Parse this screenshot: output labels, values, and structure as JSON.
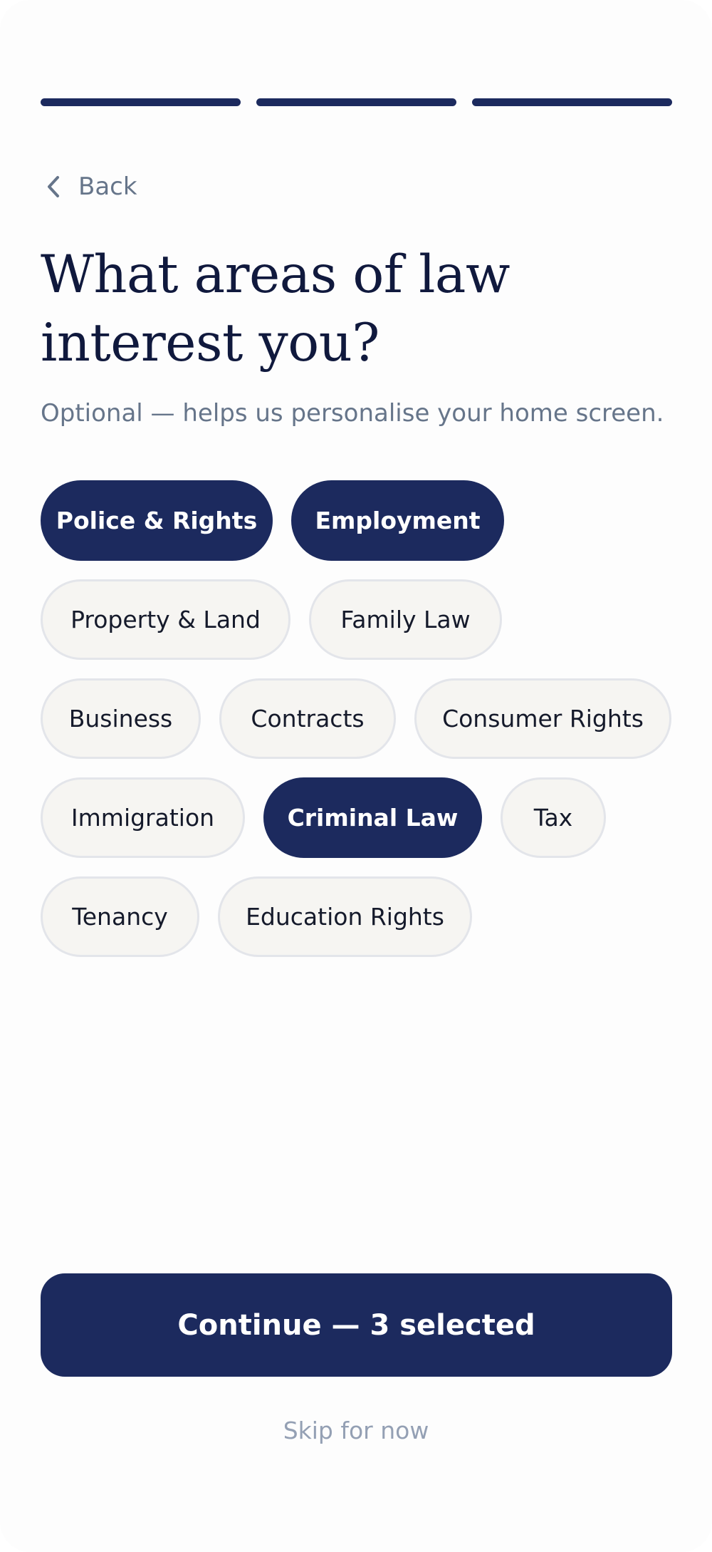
{
  "progress": {
    "total_steps": 3,
    "completed_steps": 3
  },
  "nav": {
    "back_label": "Back",
    "back_icon": "chevron-left-icon"
  },
  "heading": {
    "title_line1": "What areas of law",
    "title_line2": "interest you?",
    "subtitle": "Optional — helps us personalise your home screen."
  },
  "chips": [
    [
      {
        "label": "Police & Rights",
        "selected": true
      },
      {
        "label": "Employment",
        "selected": true
      }
    ],
    [
      {
        "label": "Property & Land",
        "selected": false
      },
      {
        "label": "Family Law",
        "selected": false
      }
    ],
    [
      {
        "label": "Business",
        "selected": false
      },
      {
        "label": "Contracts",
        "selected": false
      },
      {
        "label": "Consumer Rights",
        "selected": false
      }
    ],
    [
      {
        "label": "Immigration",
        "selected": false
      },
      {
        "label": "Criminal Law",
        "selected": true
      },
      {
        "label": "Tax",
        "selected": false
      }
    ],
    [
      {
        "label": "Tenancy",
        "selected": false
      },
      {
        "label": "Education Rights",
        "selected": false
      }
    ]
  ],
  "actions": {
    "continue_label": "Continue — 3 selected",
    "skip_label": "Skip for now"
  },
  "colors": {
    "primary": "#1c2a5e",
    "chip_bg": "#f6f5f2",
    "chip_border": "#e3e5ea",
    "muted_text": "#66758a",
    "skip_text": "#94a0b4",
    "title_text": "#10193d"
  }
}
